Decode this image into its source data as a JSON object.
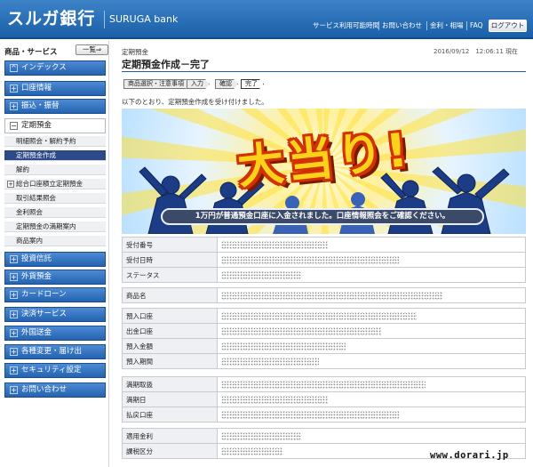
{
  "header": {
    "logo_jp": "スルガ銀行",
    "logo_en": "SURUGA bank",
    "links": [
      "サービス利用可能時間",
      "お問い合わせ",
      "金利・相場",
      "FAQ"
    ],
    "login_label": "ログアウト"
  },
  "sidebar": {
    "title": "商品・サービス",
    "list_button": "一覧⇒",
    "index_label": "インデックス",
    "top_items": [
      {
        "icon": "+",
        "label": "口座情報"
      },
      {
        "icon": "+",
        "label": "振込・振替"
      }
    ],
    "open_item": {
      "icon": "−",
      "label": "定期預金"
    },
    "sub_items": [
      {
        "label": "明細照会・解約予約"
      },
      {
        "label": "定期預金作成"
      },
      {
        "label": "解約"
      },
      {
        "label": "総合口座積立定期預金",
        "icon": "+"
      },
      {
        "label": "取引結果照会"
      },
      {
        "label": "金利照会"
      },
      {
        "label": "定期預金の満期案内"
      },
      {
        "label": "商品案内"
      }
    ],
    "bottom_items": [
      {
        "icon": "+",
        "label": "投資信託"
      },
      {
        "icon": "+",
        "label": "外貨預金"
      },
      {
        "icon": "+",
        "label": "カードローン"
      },
      {
        "icon": "+",
        "label": "決済サービス"
      },
      {
        "icon": "+",
        "label": "外国送金"
      },
      {
        "icon": "+",
        "label": "各種変更・届け出"
      },
      {
        "icon": "+",
        "label": "セキュリティ設定"
      },
      {
        "icon": "+",
        "label": "お問い合わせ"
      }
    ]
  },
  "main": {
    "breadcrumb": "定期預金",
    "datetime": "2016/09/12　12:06:11 現在",
    "title": "定期預金作成－完了",
    "steps": [
      "商品選択・注意事項",
      "入力",
      "確認",
      "完了"
    ],
    "message": "以下のとおり、定期預金作成を受け付けました。",
    "banner_text": "大当り!",
    "banner_bar": "1万円が普通預金口座に入金されました。口座情報照会をご確認ください。",
    "groups": [
      {
        "rows": [
          {
            "label": "受付番号"
          },
          {
            "label": "受付日時"
          },
          {
            "label": "ステータス"
          }
        ]
      },
      {
        "rows": [
          {
            "label": "商品名"
          }
        ]
      },
      {
        "rows": [
          {
            "label": "預入口座"
          },
          {
            "label": "出金口座"
          },
          {
            "label": "預入金額"
          },
          {
            "label": "預入期間"
          }
        ]
      },
      {
        "rows": [
          {
            "label": "満期取扱"
          },
          {
            "label": "満期日"
          },
          {
            "label": "払戻口座"
          }
        ]
      },
      {
        "rows": [
          {
            "label": "適用金利"
          },
          {
            "label": "課税区分"
          }
        ]
      }
    ]
  },
  "watermark": "www.dorari.jp",
  "colors": {
    "header_blue": "#1a5fa8",
    "nav_blue": "#2463b0",
    "active_sub": "#2c4a87"
  }
}
